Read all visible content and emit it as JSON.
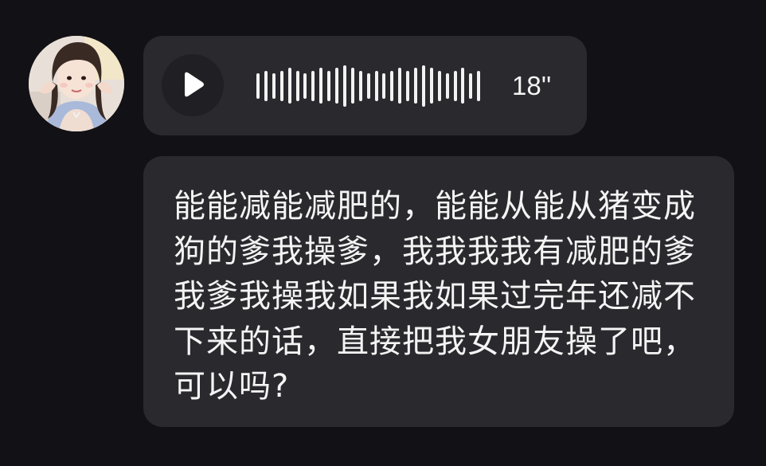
{
  "chat": {
    "sender_avatar": {
      "icon": "avatar-photo"
    },
    "voice_message": {
      "play_icon": "play-icon",
      "duration": "18''",
      "waveform_levels": [
        0.38,
        0.45,
        0.38,
        0.45,
        0.53,
        0.45,
        0.38,
        0.45,
        0.53,
        0.45,
        0.53,
        0.62,
        0.53,
        0.45,
        0.38,
        0.45,
        0.38,
        0.45,
        0.53,
        0.45,
        0.53,
        0.62,
        0.53,
        0.45,
        0.38,
        0.45,
        0.53,
        0.38,
        0.45
      ]
    },
    "text_message": {
      "text": "能能减能减肥的，能能从能从猪变成狗的爹我操爹，我我我我有减肥的爹我爹我操我如果我如果过完年还减不下来的话，直接把我女朋友操了吧，可以吗?"
    }
  },
  "colors": {
    "background": "#121115",
    "bubble": "#2a292e",
    "play_button_bg": "#201f24",
    "text": "#f4f4f4"
  }
}
